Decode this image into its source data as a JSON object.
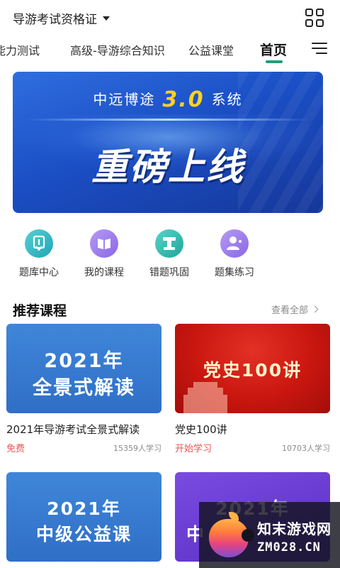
{
  "header": {
    "exam_select_label": "导游考试资格证",
    "grid_icon": "grid-icon"
  },
  "tabs": [
    {
      "label": "能力测试",
      "active": false
    },
    {
      "label": "高级-导游综合知识",
      "active": false
    },
    {
      "label": "公益课堂",
      "active": false
    },
    {
      "label": "首页",
      "active": true
    }
  ],
  "menu_icon": "menu-icon",
  "banner": {
    "line1_left": "中远博途",
    "version": "3.0",
    "line1_right": "系统",
    "line2": "重磅上线"
  },
  "entries": [
    {
      "label": "题库中心",
      "icon": "question-bank-icon",
      "color_from": "#56d1d3",
      "color_to": "#1fa4b6"
    },
    {
      "label": "我的课程",
      "icon": "book-icon",
      "color_from": "#b69af5",
      "color_to": "#8a67e6"
    },
    {
      "label": "错题巩固",
      "icon": "wrong-question-icon",
      "color_from": "#5ad3c7",
      "color_to": "#1ca79a"
    },
    {
      "label": "题集练习",
      "icon": "practice-icon",
      "color_from": "#b69af5",
      "color_to": "#8a67e6"
    }
  ],
  "section": {
    "title": "推荐课程",
    "see_all": "查看全部"
  },
  "courses": [
    {
      "thumb_line1": "2021年",
      "thumb_line2": "全景式解读",
      "title": "2021年导游考试全景式解读",
      "price": "免费",
      "learners": "15359人学习"
    },
    {
      "thumb_line1": "党史100讲",
      "thumb_line2": "",
      "title": "党史100讲",
      "price": "开始学习",
      "learners": "10703人学习"
    },
    {
      "thumb_line1": "2021年",
      "thumb_line2": "中级公益课"
    },
    {
      "thumb_line1": "2021年",
      "thumb_line2": "中"
    }
  ],
  "watermark": {
    "cn": "知末游戏网",
    "en": "ZM028.CN"
  },
  "colors": {
    "accent": "#1aa07a",
    "price": "#e8574f"
  }
}
